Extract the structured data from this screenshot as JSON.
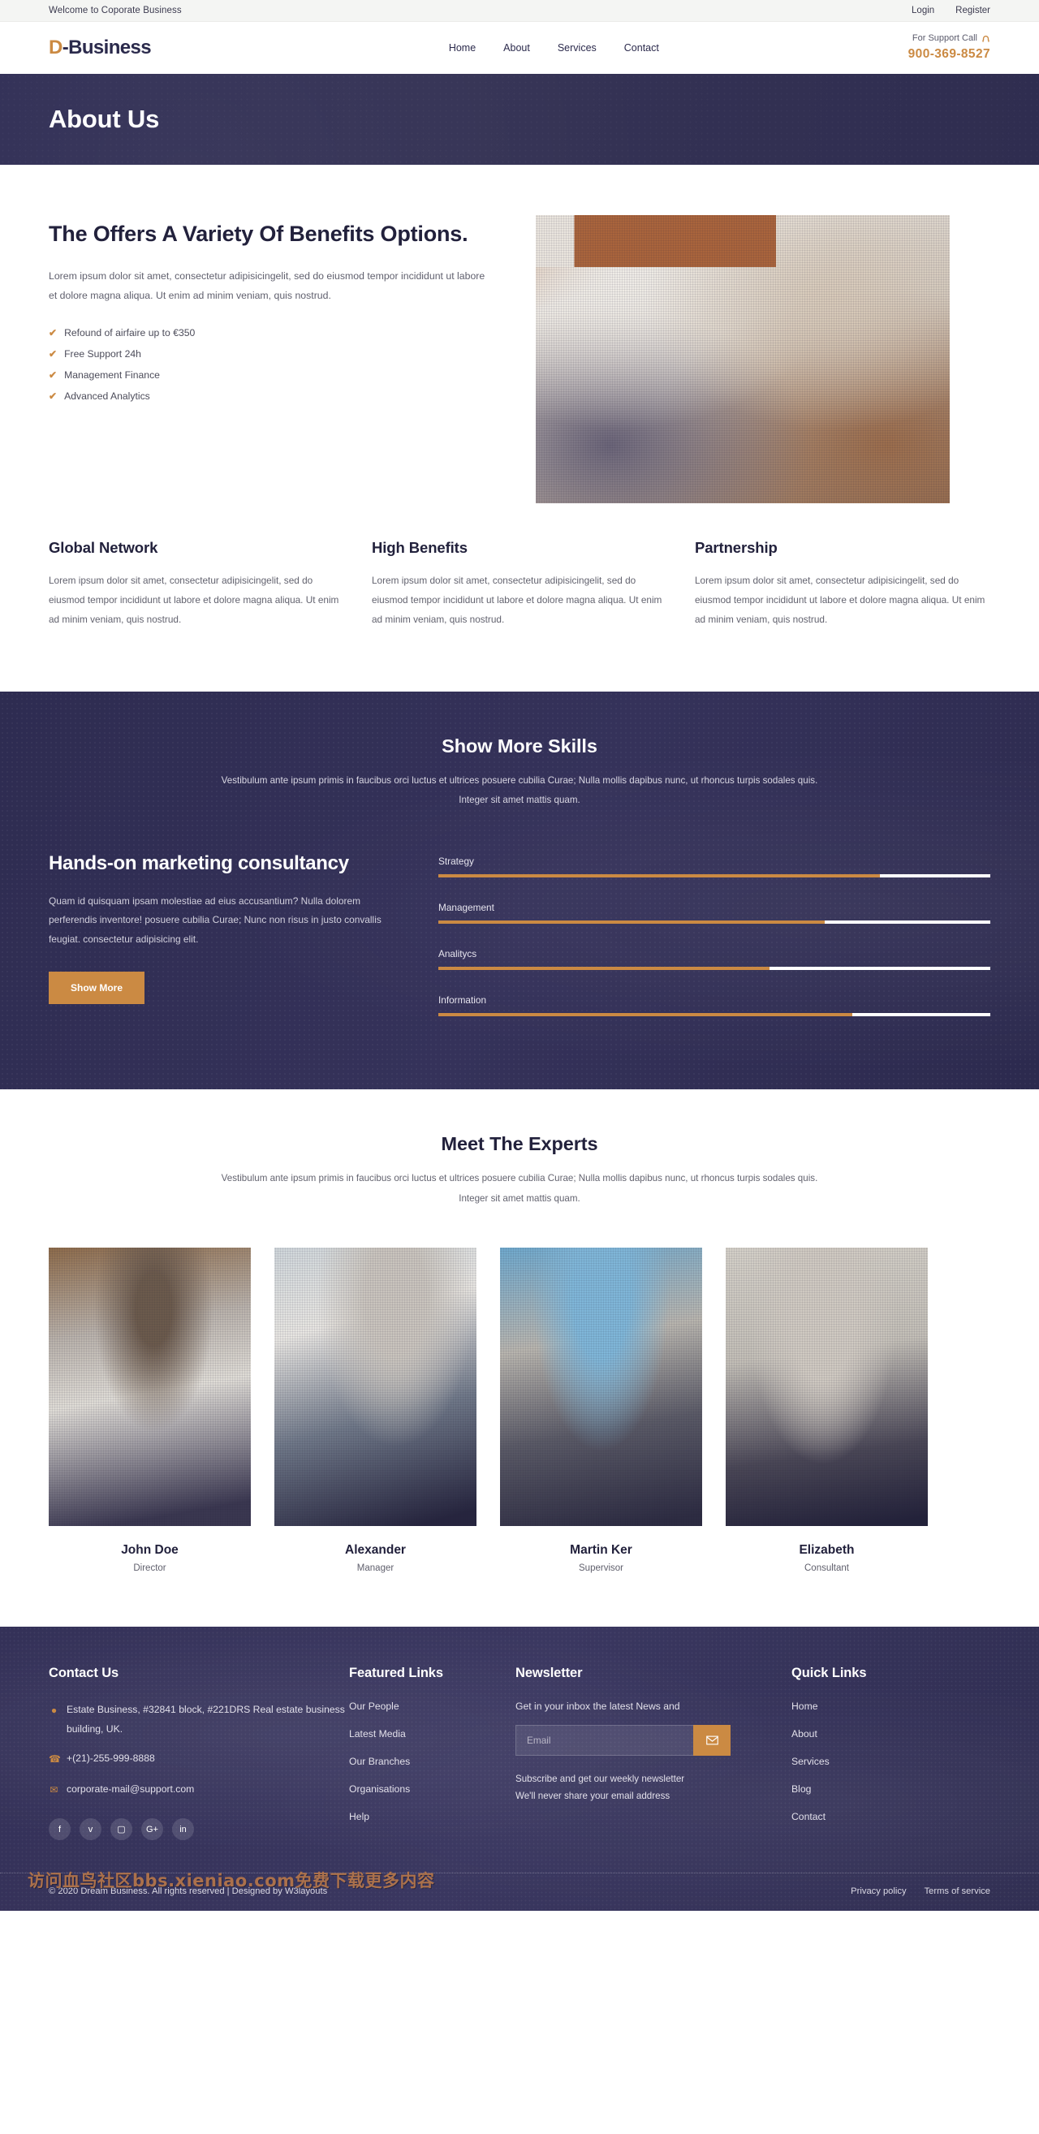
{
  "topbar": {
    "welcome": "Welcome to Coporate Business",
    "links": [
      {
        "label": "Login"
      },
      {
        "label": "Register"
      }
    ]
  },
  "header": {
    "logo_mark": "D",
    "logo_rest": "-Business",
    "nav": [
      {
        "label": "Home"
      },
      {
        "label": "About"
      },
      {
        "label": "Services"
      },
      {
        "label": "Contact"
      }
    ],
    "support_label": "For Support Call",
    "support_number": "900-369-8527"
  },
  "hero": {
    "title": "About Us"
  },
  "offers": {
    "heading": "The Offers A Variety Of Benefits Options.",
    "paragraph": "Lorem ipsum dolor sit amet, consectetur adipisicingelit, sed do eiusmod tempor incididunt ut labore et dolore magna aliqua. Ut enim ad minim veniam, quis nostrud.",
    "checklist": [
      {
        "label": "Refound of airfaire up to €350"
      },
      {
        "label": "Free Support 24h"
      },
      {
        "label": "Management Finance"
      },
      {
        "label": "Advanced Analytics"
      }
    ],
    "check_glyph": "✔"
  },
  "features": [
    {
      "title": "Global Network",
      "text": "Lorem ipsum dolor sit amet, consectetur adipisicingelit, sed do eiusmod tempor incididunt ut labore et dolore magna aliqua. Ut enim ad minim veniam, quis nostrud."
    },
    {
      "title": "High Benefits",
      "text": "Lorem ipsum dolor sit amet, consectetur adipisicingelit, sed do eiusmod tempor incididunt ut labore et dolore magna aliqua. Ut enim ad minim veniam, quis nostrud."
    },
    {
      "title": "Partnership",
      "text": "Lorem ipsum dolor sit amet, consectetur adipisicingelit, sed do eiusmod tempor incididunt ut labore et dolore magna aliqua. Ut enim ad minim veniam, quis nostrud."
    }
  ],
  "skills": {
    "title": "Show More Skills",
    "subtitle": "Vestibulum ante ipsum primis in faucibus orci luctus et ultrices posuere cubilia Curae; Nulla mollis dapibus nunc, ut rhoncus turpis sodales quis. Integer sit amet mattis quam.",
    "left_heading": "Hands-on marketing consultancy",
    "left_text": "Quam id quisquam ipsam molestiae ad eius accusantium? Nulla dolorem perferendis inventore! posuere cubilia Curae; Nunc non risus in justo convallis feugiat. consectetur adipisicing elit.",
    "button_label": "Show More",
    "bars": [
      {
        "label": "Strategy",
        "percent": 80
      },
      {
        "label": "Management",
        "percent": 70
      },
      {
        "label": "Analitycs",
        "percent": 60
      },
      {
        "label": "Information",
        "percent": 75
      }
    ]
  },
  "experts": {
    "title": "Meet The Experts",
    "subtitle": "Vestibulum ante ipsum primis in faucibus orci luctus et ultrices posuere cubilia Curae; Nulla mollis dapibus nunc, ut rhoncus turpis sodales quis. Integer sit amet mattis quam.",
    "members": [
      {
        "name": "John Doe",
        "role": "Director"
      },
      {
        "name": "Alexander",
        "role": "Manager"
      },
      {
        "name": "Martin Ker",
        "role": "Supervisor"
      },
      {
        "name": "Elizabeth",
        "role": "Consultant"
      }
    ]
  },
  "footer": {
    "contact": {
      "title": "Contact Us",
      "address": "Estate Business, #32841 block, #221DRS Real estate business building, UK.",
      "phone": "+(21)-255-999-8888",
      "email": "corporate-mail@support.com",
      "socials": [
        {
          "name": "facebook",
          "glyph": "f"
        },
        {
          "name": "twitter",
          "glyph": "ᴠ"
        },
        {
          "name": "instagram",
          "glyph": "▢"
        },
        {
          "name": "google-plus",
          "glyph": "G+"
        },
        {
          "name": "linkedin",
          "glyph": "in"
        }
      ]
    },
    "featured": {
      "title": "Featured Links",
      "links": [
        {
          "label": "Our People"
        },
        {
          "label": "Latest Media"
        },
        {
          "label": "Our Branches"
        },
        {
          "label": "Organisations"
        },
        {
          "label": "Help"
        }
      ]
    },
    "newsletter": {
      "title": "Newsletter",
      "text": "Get in your inbox the latest News and",
      "placeholder": "Email",
      "input_value": "",
      "note_line1": "Subscribe and get our weekly newsletter",
      "note_line2": "We'll never share your email address"
    },
    "quick": {
      "title": "Quick Links",
      "links": [
        {
          "label": "Home"
        },
        {
          "label": "About"
        },
        {
          "label": "Services"
        },
        {
          "label": "Blog"
        },
        {
          "label": "Contact"
        }
      ]
    },
    "copyright": "© 2020 Dream Business. All rights reserved | Designed by W3layouts",
    "legal": [
      {
        "label": "Privacy policy"
      },
      {
        "label": "Terms of service"
      }
    ],
    "watermark": "访问血鸟社区bbs.xieniao.com免费下载更多内容"
  },
  "colors": {
    "accent": "#cb8a43",
    "dark": "#2e2c51",
    "navy_text": "#22213c"
  }
}
